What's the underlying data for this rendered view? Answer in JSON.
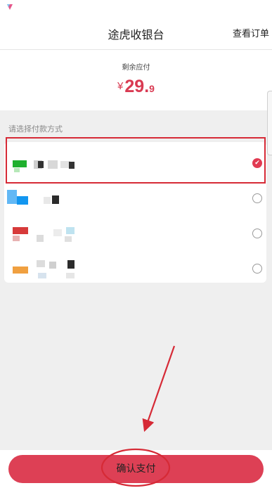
{
  "header": {
    "title": "途虎收银台",
    "orders_link": "查看订单"
  },
  "amount": {
    "label": "剩余应付",
    "currency": "¥",
    "integer": "29.",
    "decimal": "9"
  },
  "payment": {
    "section_label": "请选择付款方式",
    "methods": [
      {
        "selected": true,
        "icon_color": "#1fb02e"
      },
      {
        "selected": false,
        "icon_color": "#1296f0"
      },
      {
        "selected": false,
        "icon_color": "#d73a3a"
      },
      {
        "selected": false,
        "icon_color": "#f0a040"
      }
    ]
  },
  "footer": {
    "pay_button": "确认支付"
  },
  "colors": {
    "accent": "#dd4055",
    "price": "#d93a52",
    "annotation": "#d62a36"
  }
}
